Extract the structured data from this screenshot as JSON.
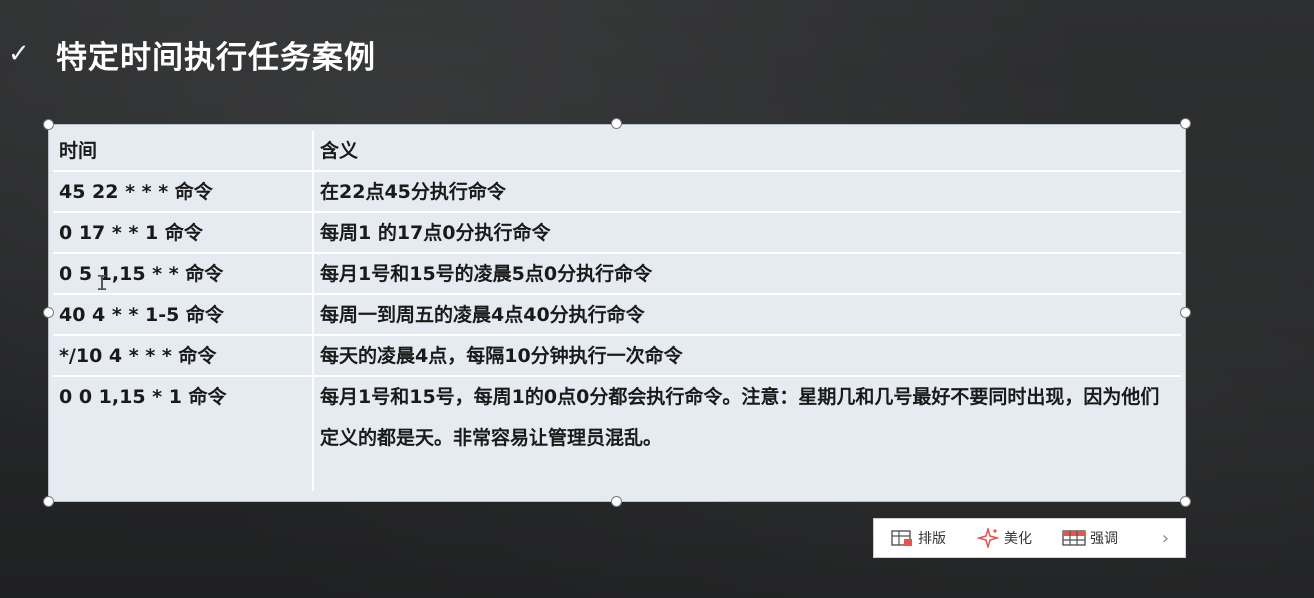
{
  "slide": {
    "title": "特定时间执行任务案例",
    "bullet_icon": "check-icon"
  },
  "table": {
    "headers": [
      "时间",
      "含义"
    ],
    "rows": [
      {
        "time": "45 22 * * * 命令",
        "meaning": "在22点45分执行命令"
      },
      {
        "time": "0 17 * * 1 命令",
        "meaning": "每周1 的17点0分执行命令"
      },
      {
        "time": "0 5 1,15 * * 命令",
        "meaning": "每月1号和15号的凌晨5点0分执行命令"
      },
      {
        "time": "40 4 * * 1-5 命令",
        "meaning": "每周一到周五的凌晨4点40分执行命令"
      },
      {
        "time": "*/10 4 * * * 命令",
        "meaning": "每天的凌晨4点，每隔10分钟执行一次命令"
      },
      {
        "time": "0 0 1,15 * 1 命令",
        "meaning": "每月1号和15号，每周1的0点0分都会执行命令。注意：星期几和几号最好不要同时出现，因为他们定义的都是天。非常容易让管理员混乱。"
      }
    ]
  },
  "toolbar": {
    "layout_label": "排版",
    "beautify_label": "美化",
    "emphasis_label": "强调",
    "layout_icon": "table-layout-icon",
    "beautify_icon": "sparkle-icon",
    "emphasis_icon": "grid-highlight-icon",
    "more_icon": "chevron-right-icon"
  },
  "colors": {
    "slide_background": "#2a2b2c",
    "table_background": "#e6ebf2",
    "table_divider": "#ffffff",
    "title_text": "#ffffff"
  }
}
